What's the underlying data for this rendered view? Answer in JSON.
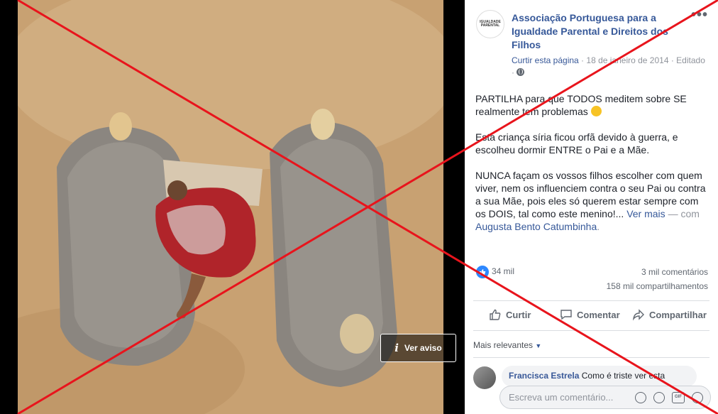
{
  "post": {
    "page_name": "Associação Portuguesa para a Igualdade Parental e Direitos dos Filhos",
    "avatar_text": "IGUALDADE PARENTAL",
    "like_page": "Curtir esta página",
    "separator": " · ",
    "date": "18 de janeiro de 2014",
    "edited": "Editado",
    "paragraphs": [
      "PARTILHA para que TODOS meditem sobre SE realmente tem problemas",
      "Esta criança síria ficou orfã devido à guerra, e escolheu dormir ENTRE o Pai e a Mãe.",
      "NUNCA façam os vossos filhos escolher com quem viver, nem os influenciem contra o seu Pai ou contra a sua Mãe, pois eles só querem estar sempre com os DOIS, tal como este menino!..."
    ],
    "see_more": "Ver mais",
    "with_text": "— com",
    "tagged": "Augusta Bento Catumbinha",
    "period": "."
  },
  "stats": {
    "likes": "34 mil",
    "comments": "3 mil comentários",
    "shares": "158 mil compartilhamentos"
  },
  "actions": {
    "like": "Curtir",
    "comment": "Comentar",
    "share": "Compartilhar"
  },
  "comments": {
    "sort_label": "Mais relevantes",
    "first_author": "Francisca Estrela",
    "first_text": "Como é triste ver esta",
    "composer_placeholder": "Escreva um comentário..."
  },
  "photo": {
    "warning_button": "Ver aviso",
    "icons": {
      "like": "thumbs-up-icon",
      "comment": "speech-bubble-icon",
      "share": "share-arrow-icon",
      "audience": "globe-icon",
      "warning": "info-icon"
    }
  },
  "colors": {
    "brand_link": "#365899",
    "like_blue": "#2d88ff",
    "overlay_x": "#e8141c"
  }
}
